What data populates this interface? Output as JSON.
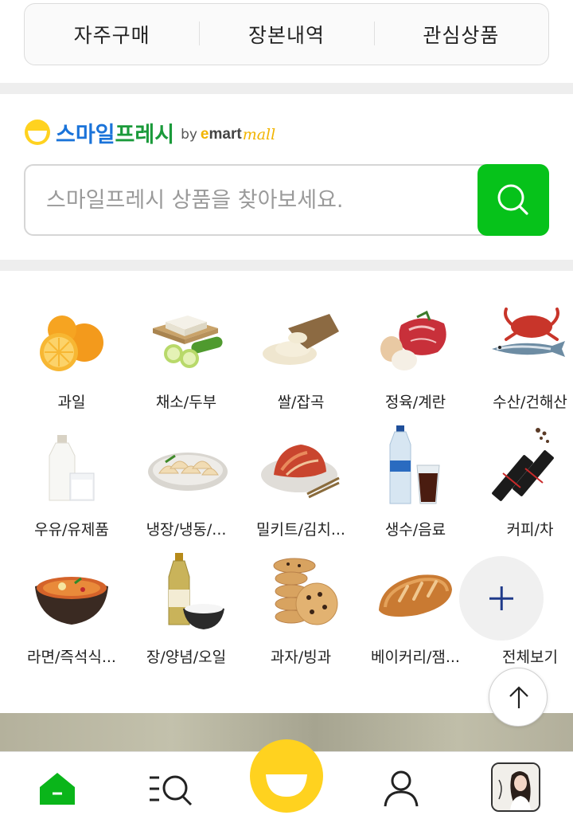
{
  "top_tabs": [
    "자주구매",
    "장본내역",
    "관심상품"
  ],
  "brand": {
    "title_part1": "스마일",
    "title_part2": "프레시",
    "by": "by",
    "emart_e": "e",
    "emart_rest": "mart",
    "mall": "mall"
  },
  "search": {
    "placeholder": "스마일프레시 상품을 찾아보세요.",
    "button_icon": "search-icon"
  },
  "categories": [
    {
      "label": "과일",
      "icon": "orange-icon"
    },
    {
      "label": "채소/두부",
      "icon": "tofu-cucumber-icon"
    },
    {
      "label": "쌀/잡곡",
      "icon": "rice-sack-icon"
    },
    {
      "label": "정육/계란",
      "icon": "meat-egg-icon"
    },
    {
      "label": "수산/건해산",
      "icon": "crab-fish-icon"
    },
    {
      "label": "우유/유제품",
      "icon": "milk-icon"
    },
    {
      "label": "냉장/냉동/...",
      "icon": "dumpling-icon"
    },
    {
      "label": "밀키트/김치...",
      "icon": "kimchi-icon"
    },
    {
      "label": "생수/음료",
      "icon": "water-bottle-icon"
    },
    {
      "label": "커피/차",
      "icon": "coffee-stick-icon"
    },
    {
      "label": "라면/즉석식...",
      "icon": "ramen-icon"
    },
    {
      "label": "장/양념/오일",
      "icon": "oil-salt-icon"
    },
    {
      "label": "과자/빙과",
      "icon": "cookie-icon"
    },
    {
      "label": "베이커리/잼...",
      "icon": "bread-icon"
    },
    {
      "label": "전체보기",
      "icon": "plus-icon"
    }
  ],
  "bottom_nav": [
    "home-icon",
    "category-search-icon",
    "smile-icon",
    "my-page-icon",
    "recent-viewed-avatar"
  ],
  "colors": {
    "accent_green": "#06c21a",
    "smile_yellow": "#ffd21f",
    "brand_blue": "#1a73d9",
    "brand_green": "#1a9a3a"
  }
}
